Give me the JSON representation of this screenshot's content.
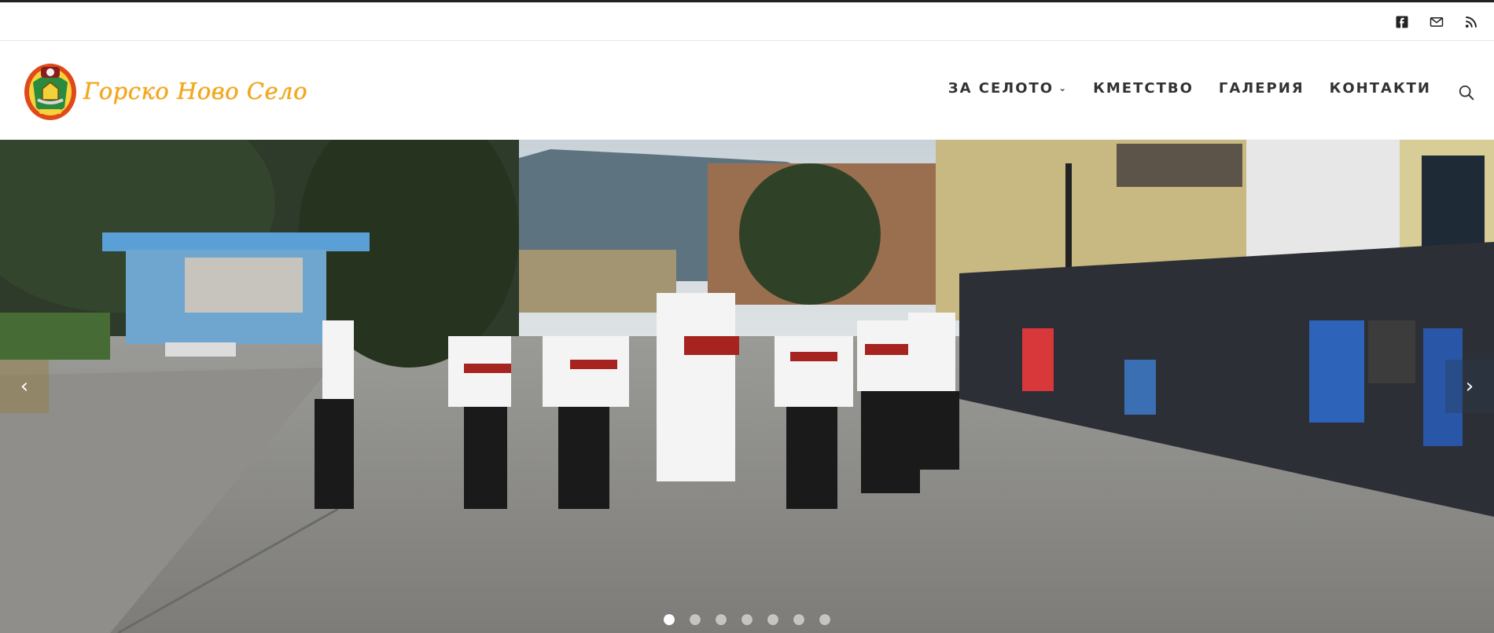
{
  "topbar": {
    "social_icons": [
      "facebook-icon",
      "mail-icon",
      "rss-icon"
    ]
  },
  "header": {
    "site_title": "Горско Ново Село",
    "nav": [
      {
        "label": "ЗА СЕЛОТО",
        "has_dropdown": true
      },
      {
        "label": "КМЕТСТВО",
        "has_dropdown": false
      },
      {
        "label": "ГАЛЕРИЯ",
        "has_dropdown": false
      },
      {
        "label": "КОНТАКТИ",
        "has_dropdown": false
      }
    ],
    "chevron_glyph": "⌄",
    "search_icon": "search-icon"
  },
  "hero": {
    "prev_glyph": "‹",
    "next_glyph": "›",
    "slide_count": 7,
    "active_slide": 1
  },
  "colors": {
    "accent": "#f2a818",
    "nav_text": "#333333",
    "topbar_border": "#222222"
  }
}
